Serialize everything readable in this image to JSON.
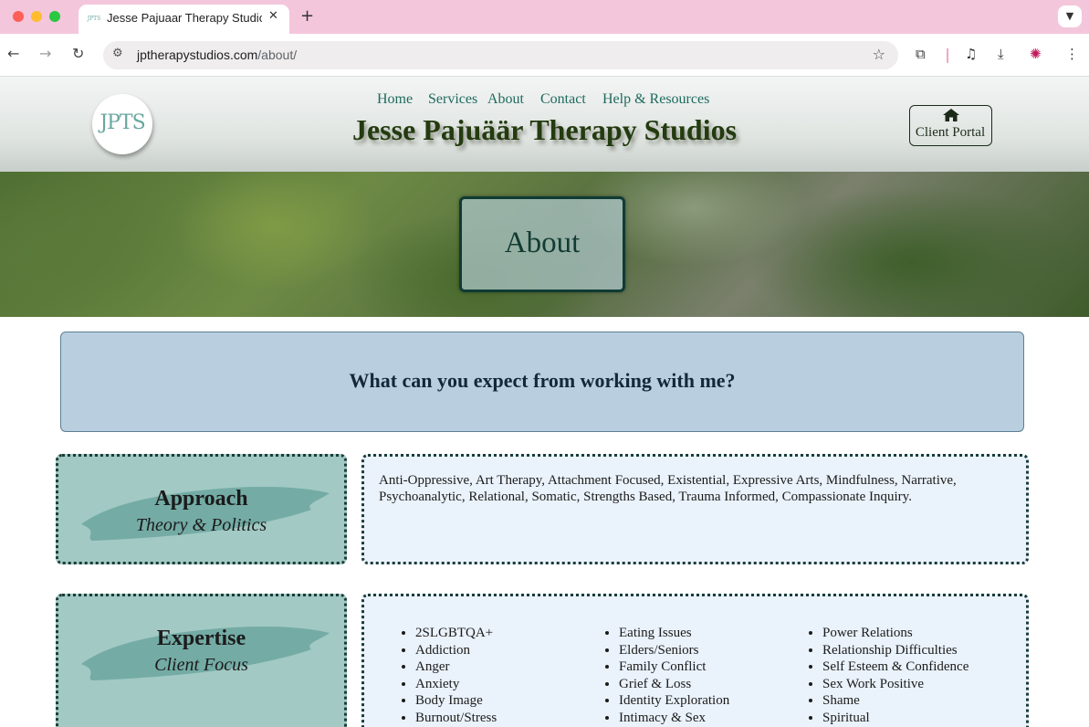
{
  "browser": {
    "tab_title": "Jesse Pajuaar Therapy Studio",
    "tab_favicon": "JPTS",
    "url_domain": "jptherapystudios.com",
    "url_path": "/about/"
  },
  "header": {
    "logo_text": "JPTS",
    "nav": [
      "Home",
      "Services",
      "About",
      "Contact",
      "Help & Resources"
    ],
    "title": "Jesse Pajuäär Therapy Studios",
    "portal_label": "Client Portal"
  },
  "hero": {
    "title": "About"
  },
  "intro": {
    "text": "What can you expect from working with me?"
  },
  "approach": {
    "title": "Approach",
    "subtitle": "Theory & Politics",
    "text": "Anti-Oppressive, Art Therapy, Attachment Focused, Existential, Expressive Arts, Mindfulness, Narrative, Psychoanalytic, Relational, Somatic, Strengths Based, Trauma Informed, Compassionate Inquiry."
  },
  "expertise": {
    "title": "Expertise",
    "subtitle": "Client Focus",
    "col1": [
      "2SLGBTQA+",
      "Addiction",
      "Anger",
      "Anxiety",
      "Body Image",
      "Burnout/Stress"
    ],
    "col2": [
      "Eating Issues",
      "Elders/Seniors",
      "Family Conflict",
      "Grief & Loss",
      "Identity Exploration",
      "Intimacy & Sex"
    ],
    "col3": [
      "Power Relations",
      "Relationship Difficulties",
      "Self Esteem & Confidence",
      "Sex Work Positive",
      "Shame",
      "Spiritual"
    ]
  },
  "colors": {
    "accent_teal": "#1e6a5e",
    "title_green": "#233b0f",
    "banner_blue": "#b9cfe0",
    "label_teal": "#a2c9c3",
    "body_blue": "#eaf2fb"
  }
}
